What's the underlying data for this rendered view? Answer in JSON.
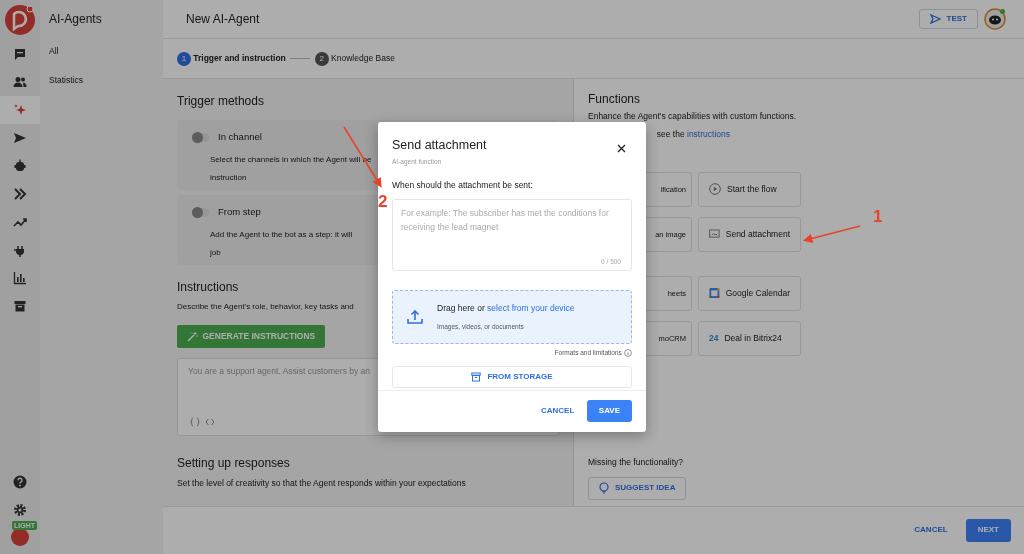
{
  "rail": {
    "items": [
      {
        "kind": "chat",
        "selected": false
      },
      {
        "kind": "people",
        "selected": false
      },
      {
        "kind": "sparkle",
        "selected": true
      },
      {
        "kind": "send",
        "selected": false
      },
      {
        "kind": "bot",
        "selected": false
      },
      {
        "kind": "chevrons",
        "selected": false
      },
      {
        "kind": "trend",
        "selected": false
      },
      {
        "kind": "plug",
        "selected": false
      },
      {
        "kind": "chart",
        "selected": false
      },
      {
        "kind": "box",
        "selected": false
      }
    ],
    "badge": "LIGHT"
  },
  "sidebar": {
    "title": "AI-Agents",
    "items": [
      "All",
      "Statistics"
    ]
  },
  "header": {
    "title": "New AI-Agent",
    "test_button": "TEST"
  },
  "steps": [
    {
      "number": "1",
      "label": "Trigger and instruction",
      "selected": true
    },
    {
      "number": "2",
      "label": "Knowledge Base",
      "selected": false
    }
  ],
  "trigger_methods": {
    "title": "Trigger methods",
    "options": [
      {
        "label": "In channel",
        "on": false,
        "description_lines": [
          "Select the channels in which the Agent will be",
          "instruction"
        ]
      },
      {
        "label": "From step",
        "on": false,
        "description_lines": [
          "Add the Agent to the bot as a step: it will",
          "job"
        ]
      }
    ]
  },
  "instructions": {
    "title": "Instructions",
    "description": "Describe the Agent's role, behavior, key tasks and",
    "generate_button": "GENERATE INSTRUCTIONS",
    "placeholder": "You are a support agent. Assist customers by an"
  },
  "responses": {
    "title": "Setting up responses",
    "description": "Set the level of creativity so that the Agent responds within your expectations"
  },
  "functions": {
    "title": "Functions",
    "description": "Enhance the Agent's capabilities with custom functions.",
    "link_prefix": "see the ",
    "link": "instructions",
    "tiles": [
      {
        "kind": "cut",
        "label": "ification"
      },
      {
        "kind": "play",
        "label": "Start the flow"
      },
      {
        "kind": "cut",
        "label": "an image"
      },
      {
        "kind": "attachment",
        "label": "Send attachment"
      },
      {
        "kind": "cut",
        "label": "heets"
      },
      {
        "kind": "calendar",
        "label": "Google Calendar"
      },
      {
        "kind": "cut",
        "label": "moCRM"
      },
      {
        "kind": "bitrix",
        "label": "Deal in Bitrix24",
        "logo_text": "24"
      }
    ],
    "missing": "Missing the functionality?",
    "suggest_button": "SUGGEST IDEA"
  },
  "footer": {
    "cancel": "CANCEL",
    "next": "NEXT"
  },
  "modal": {
    "title": "Send attachment",
    "subtitle": "AI-agent function",
    "question": "When should the attachment be sent:",
    "placeholder": "For example: The subscriber has met the conditions for receiving the lead magnet",
    "counter": "0 / 500",
    "drop_text": "Drag here or ",
    "drop_link": "select from your device",
    "drop_hint": "Images, videos, or documents",
    "formats": "Formats and limitations",
    "storage_button": "FROM STORAGE",
    "cancel": "CANCEL",
    "save": "SAVE"
  },
  "annotations": [
    {
      "label": "2"
    },
    {
      "label": "1"
    }
  ]
}
